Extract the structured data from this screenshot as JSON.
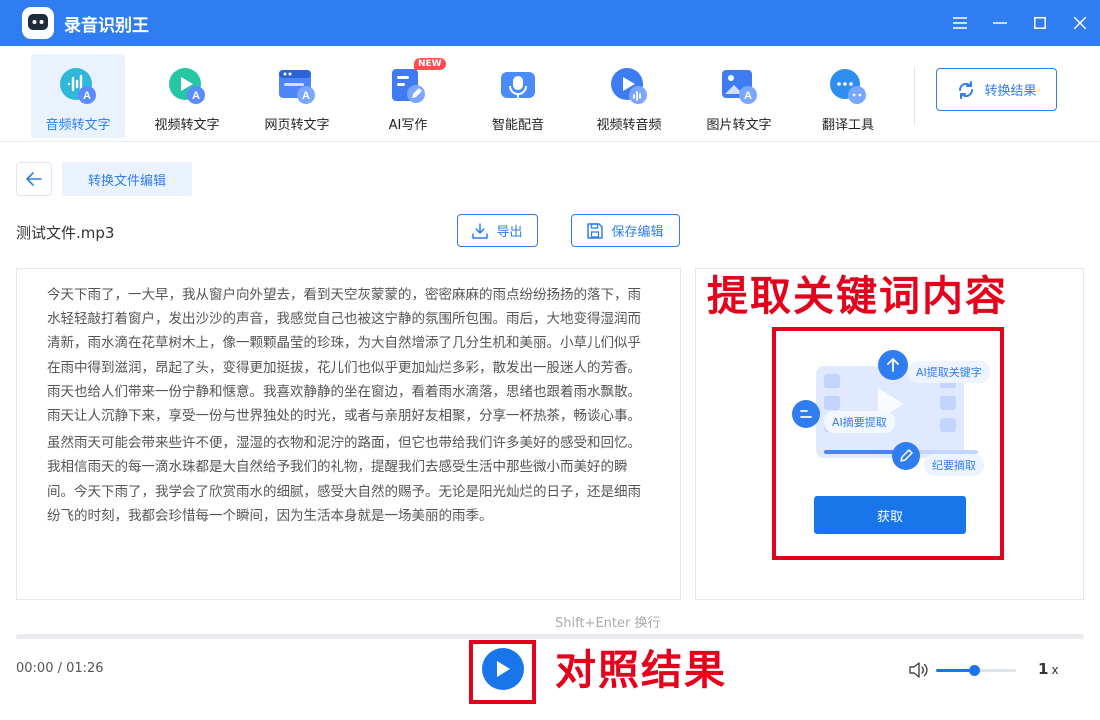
{
  "app": {
    "title": "录音识别王"
  },
  "toolbar": {
    "tools": [
      {
        "label": "音频转文字",
        "icon": "audio-to-text-icon",
        "active": true
      },
      {
        "label": "视频转文字",
        "icon": "video-to-text-icon"
      },
      {
        "label": "网页转文字",
        "icon": "webpage-to-text-icon"
      },
      {
        "label": "AI写作",
        "icon": "ai-writing-icon",
        "badge": "NEW"
      },
      {
        "label": "智能配音",
        "icon": "smart-dubbing-icon"
      },
      {
        "label": "视频转音频",
        "icon": "video-to-audio-icon"
      },
      {
        "label": "图片转文字",
        "icon": "image-to-text-icon"
      },
      {
        "label": "翻译工具",
        "icon": "translate-icon"
      }
    ],
    "result_button": "转换结果"
  },
  "editor": {
    "tab": "转换文件编辑",
    "filename": "测试文件.mp3",
    "export_label": "导出",
    "save_label": "保存编辑",
    "paragraphs": [
      "今天下雨了，一大早，我从窗户向外望去，看到天空灰蒙蒙的，密密麻麻的雨点纷纷扬扬的落下，雨水轻轻敲打着窗户，发出沙沙的声音，我感觉自己也被这宁静的氛围所包围。雨后，大地变得湿润而清新，雨水滴在花草树木上，像一颗颗晶莹的珍珠，为大自然增添了几分生机和美丽。小草儿们似乎在雨中得到滋润，昂起了头，变得更加挺拔，花儿们也似乎更加灿烂多彩，散发出一股迷人的芳香。雨天也给人们带来一份宁静和惬意。我喜欢静静的坐在窗边，看着雨水滴落，思绪也跟着雨水飘散。雨天让人沉静下来，享受一份与世界独处的时光，或者与亲朋好友相聚，分享一杯热茶，畅谈心事。",
      "虽然雨天可能会带来些许不便，湿湿的衣物和泥泞的路面，但它也带给我们许多美好的感受和回忆。我相信雨天的每一滴水珠都是大自然给予我们的礼物，提醒我们去感受生活中那些微小而美好的瞬间。今天下雨了，我学会了欣赏雨水的细腻，感受大自然的赐予。无论是阳光灿烂的日子，还是细雨纷飞的时刻，我都会珍惜每一个瞬间，因为生活本身就是一场美丽的雨季。"
    ],
    "hint": "Shift+Enter 换行"
  },
  "keyword_panel": {
    "annotation": "提取关键词内容",
    "tag_extract_keywords": "AI提取关键字",
    "tag_summary": "AI摘要提取",
    "tag_minutes": "纪要摘取",
    "fetch_label": "获取"
  },
  "player": {
    "time": "00:00 / 01:26",
    "progress": 0,
    "volume": 0.48,
    "speed_value": "1",
    "speed_unit": "x",
    "annotation": "对照结果"
  },
  "colors": {
    "primary": "#2f7df0",
    "annotation_red": "#e5001c"
  }
}
